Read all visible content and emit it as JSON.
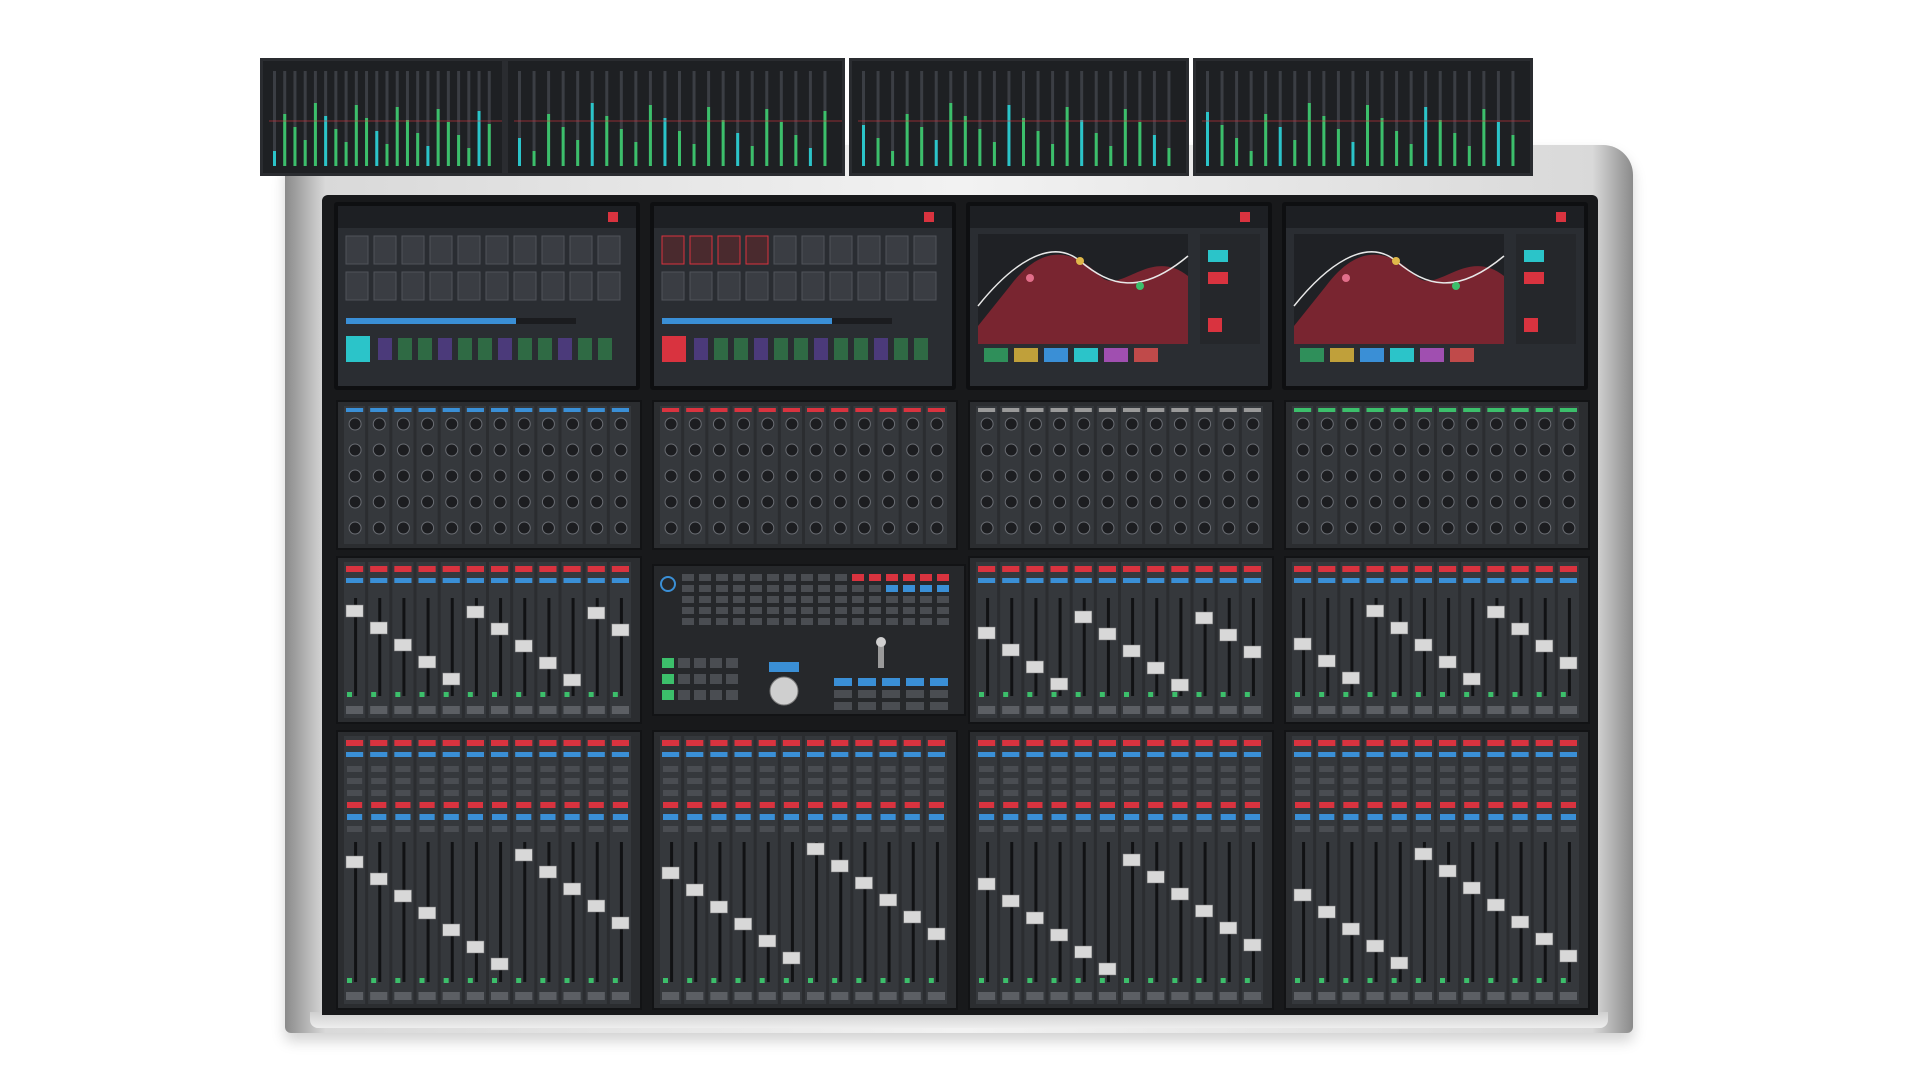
{
  "scene": {
    "subject": "broadcast-audio-mixing-console",
    "colors": {
      "background": "#ffffff",
      "frame": "#e8e8e8",
      "panel": "#2b2d30",
      "screen_bg": "#2a2d32",
      "accent_red": "#d9333f",
      "accent_blue": "#3a8fd6",
      "accent_green": "#3cbf6b",
      "accent_cyan": "#2bc4c9",
      "eq_fill": "#8a2633"
    }
  },
  "meter_bridge": {
    "panel_count": 4
  },
  "touch_screens": [
    {
      "view": "channel-grid"
    },
    {
      "view": "channel-grid-red"
    },
    {
      "view": "eq-curve"
    },
    {
      "view": "eq-curve"
    }
  ],
  "surface": {
    "tier_count": 3,
    "bay_count": 4,
    "faders_per_bay": 12
  }
}
